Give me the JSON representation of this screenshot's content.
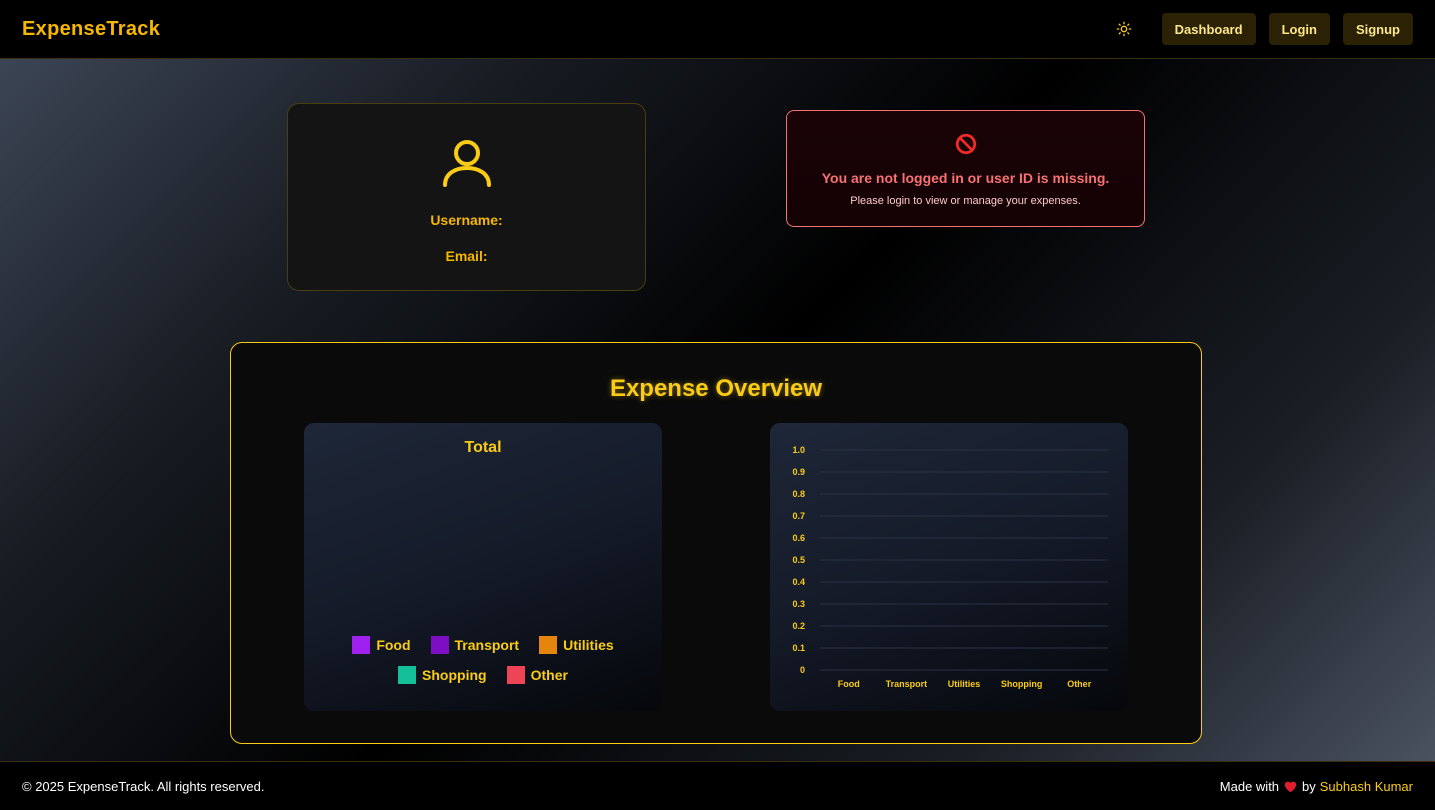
{
  "header": {
    "brand": "ExpenseTrack",
    "theme_icon": "sun-icon",
    "nav": [
      "Dashboard",
      "Login",
      "Signup"
    ]
  },
  "profile": {
    "icon": "user-icon",
    "username_label": "Username:",
    "email_label": "Email:"
  },
  "error": {
    "icon": "prohibited-icon",
    "title": "You are not logged in or user ID is missing.",
    "subtitle": "Please login to view or manage your expenses."
  },
  "overview": {
    "title": "Expense Overview"
  },
  "colors": {
    "accent": "#facc15",
    "error": "#f87171"
  },
  "chart_data": [
    {
      "type": "pie",
      "title": "Total",
      "categories": [
        "Food",
        "Transport",
        "Utilities",
        "Shopping",
        "Other"
      ],
      "colors": [
        "#a020f0",
        "#7e0ec4",
        "#e6850e",
        "#13c09a",
        "#ef4456"
      ],
      "values": [
        0,
        0,
        0,
        0,
        0
      ],
      "legend": "bottom"
    },
    {
      "type": "bar",
      "categories": [
        "Food",
        "Transport",
        "Utilities",
        "Shopping",
        "Other"
      ],
      "values": [
        0,
        0,
        0,
        0,
        0
      ],
      "ylim": [
        0,
        1.0
      ],
      "yticks": [
        "0",
        "0.1",
        "0.2",
        "0.3",
        "0.4",
        "0.5",
        "0.6",
        "0.7",
        "0.8",
        "0.9",
        "1.0"
      ],
      "grid": true
    }
  ],
  "footer": {
    "copyright": "© 2025 ExpenseTrack. All rights reserved.",
    "made_with": "Made with",
    "by": "by",
    "author": "Subhash Kumar",
    "heart_icon": "heart-icon"
  }
}
